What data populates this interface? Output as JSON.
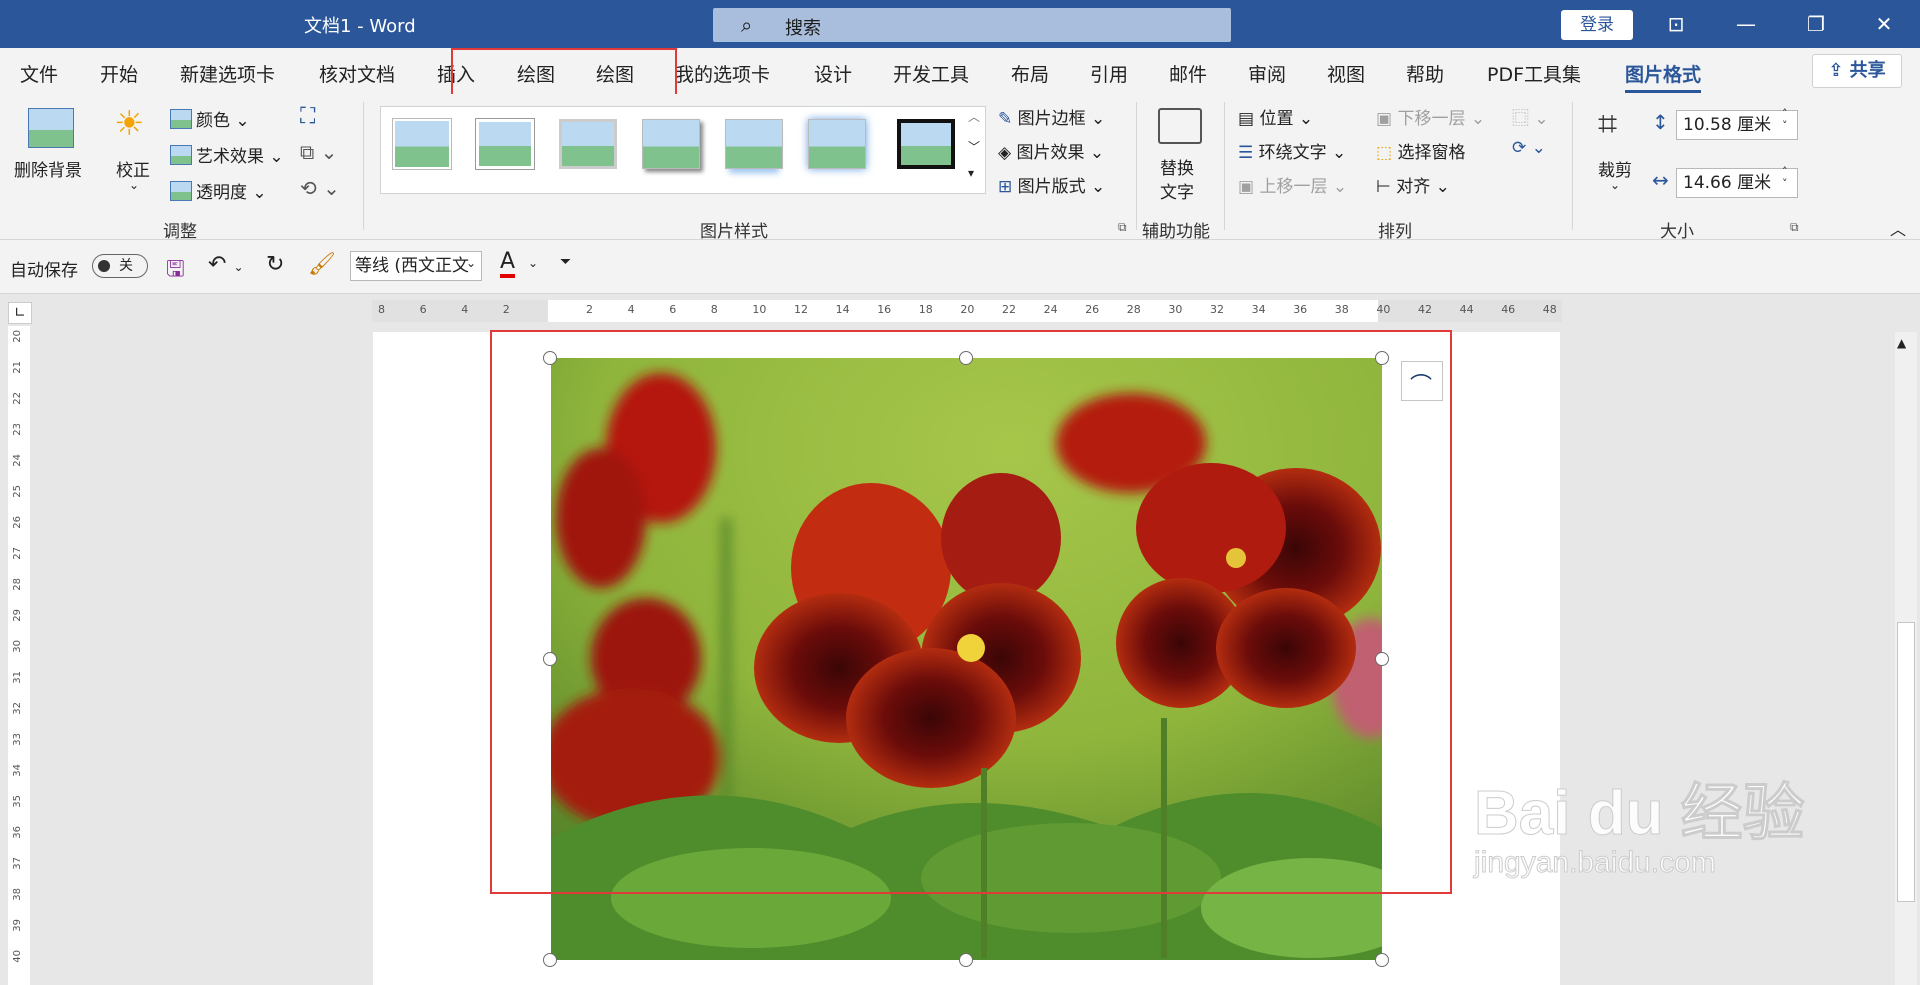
{
  "titlebar": {
    "title": "文档1  -  Word",
    "search_placeholder": "搜索",
    "login": "登录"
  },
  "tabs": [
    "文件",
    "开始",
    "新建选项卡",
    "核对文档",
    "插入",
    "绘图",
    "绘图",
    "我的选项卡",
    "设计",
    "开发工具",
    "布局",
    "引用",
    "邮件",
    "审阅",
    "视图",
    "帮助",
    "PDF工具集",
    "图片格式"
  ],
  "share": "共享",
  "ribbon": {
    "adjust": {
      "remove_bg": "删除背景",
      "correct": "校正",
      "color": "颜色",
      "artistic": "艺术效果",
      "transparency": "透明度",
      "group": "调整"
    },
    "styles": {
      "border": "图片边框",
      "effects": "图片效果",
      "layout": "图片版式",
      "group": "图片样式"
    },
    "accessibility": {
      "alt_text_line1": "替换",
      "alt_text_line2": "文字",
      "group": "辅助功能"
    },
    "arrange": {
      "position": "位置",
      "wrap": "环绕文字",
      "forward": "上移一层",
      "backward": "下移一层",
      "pane": "选择窗格",
      "align": "对齐",
      "group": "排列"
    },
    "size": {
      "crop": "裁剪",
      "height": "10.58 厘米",
      "width": "14.66 厘米",
      "group": "大小"
    }
  },
  "qat": {
    "autosave": "自动保存",
    "toggle": "关",
    "font": "等线 (西文正文"
  },
  "hruler": [
    "8",
    "6",
    "4",
    "2",
    "",
    "2",
    "4",
    "6",
    "8",
    "10",
    "12",
    "14",
    "16",
    "18",
    "20",
    "22",
    "24",
    "26",
    "28",
    "30",
    "32",
    "34",
    "36",
    "38",
    "40",
    "42",
    "44",
    "46",
    "48"
  ],
  "vruler": [
    "20",
    "21",
    "22",
    "23",
    "24",
    "25",
    "26",
    "27",
    "28",
    "29",
    "30",
    "31",
    "32",
    "33",
    "34",
    "35",
    "36",
    "37",
    "38",
    "39",
    "40"
  ],
  "watermark": {
    "logo": "Bai  du 经验",
    "url": "jingyan.baidu.com"
  },
  "colors": {
    "accent": "#2b579a",
    "highlight": "#e03a3a"
  }
}
